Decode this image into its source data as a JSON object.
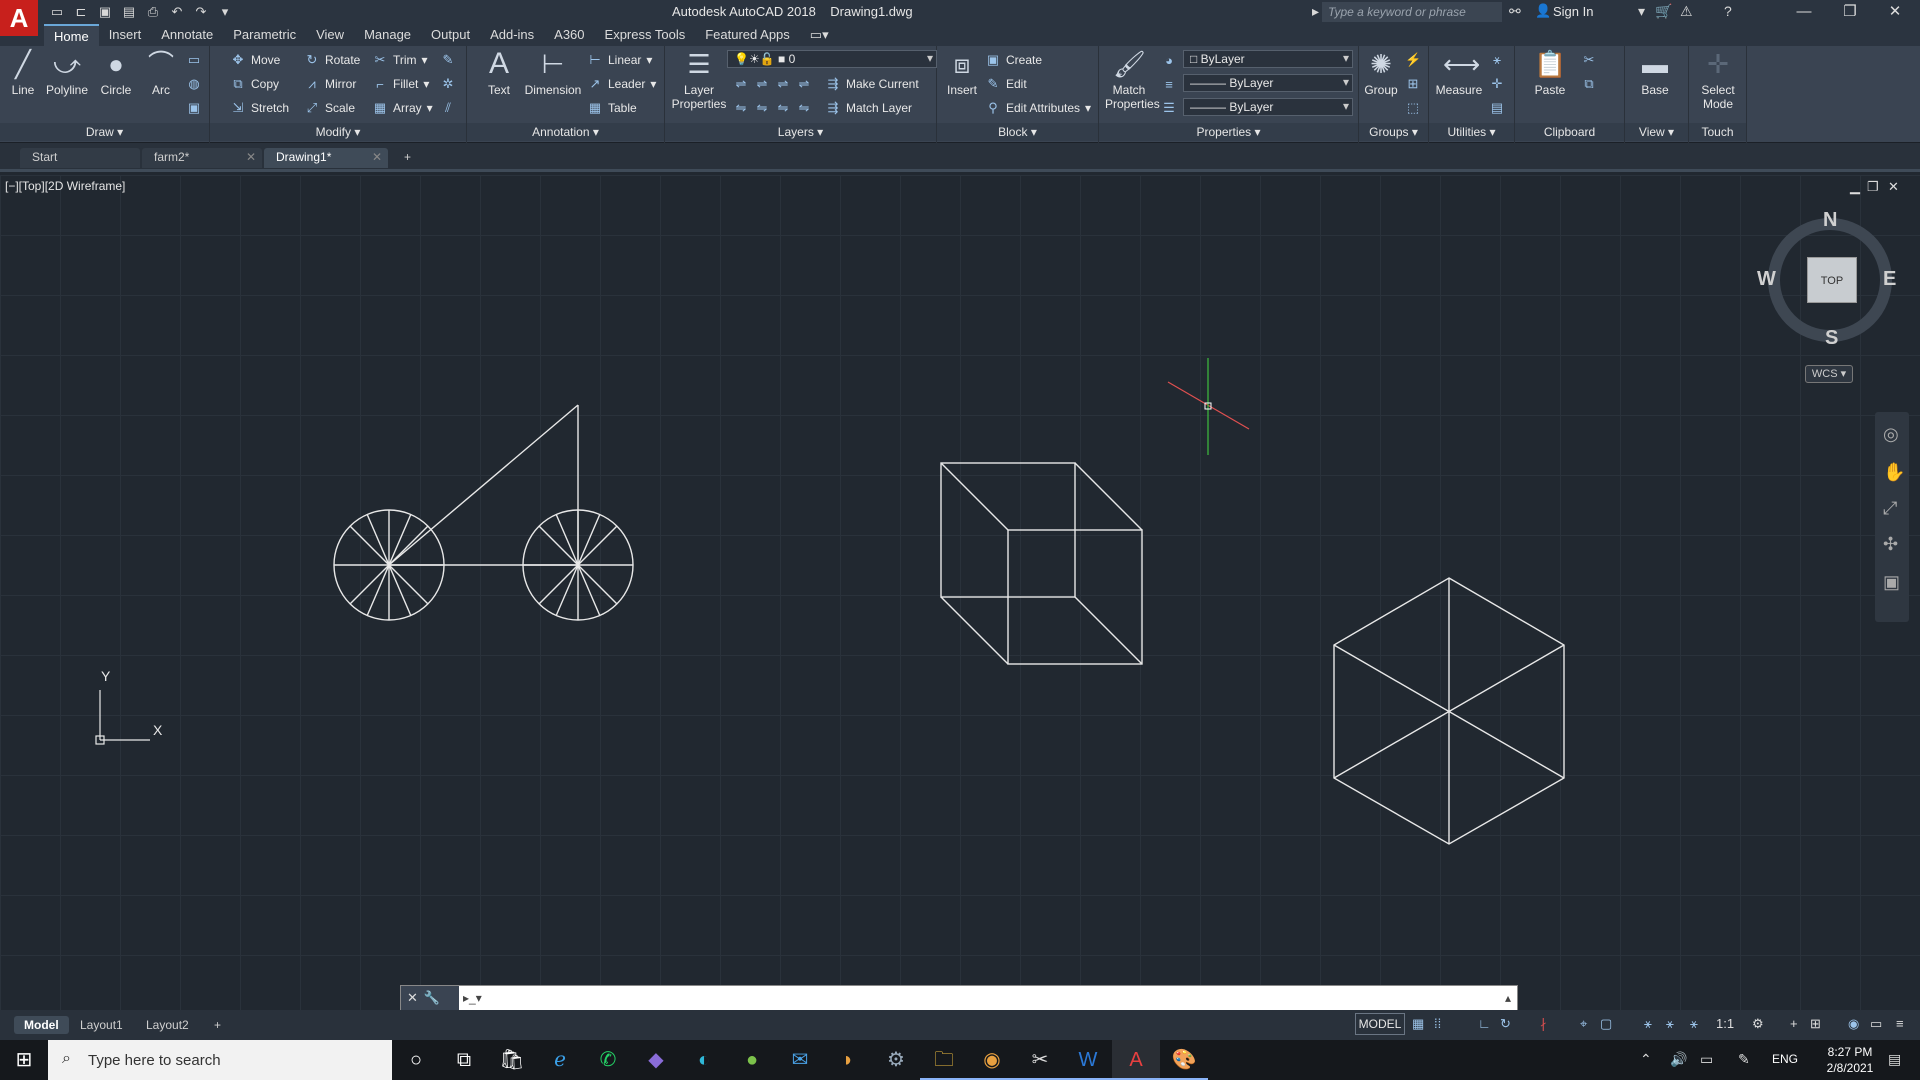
{
  "window": {
    "app_title": "Autodesk AutoCAD 2018    Drawing1.dwg",
    "search_placeholder": "Type a keyword or phrase",
    "sign_in": "Sign In"
  },
  "ribbon_tabs": [
    "Home",
    "Insert",
    "Annotate",
    "Parametric",
    "View",
    "Manage",
    "Output",
    "Add-ins",
    "A360",
    "Express Tools",
    "Featured Apps"
  ],
  "ribbon": {
    "draw": {
      "title": "Draw",
      "line": "Line",
      "polyline": "Polyline",
      "circle": "Circle",
      "arc": "Arc"
    },
    "modify": {
      "title": "Modify",
      "move": "Move",
      "rotate": "Rotate",
      "trim": "Trim",
      "copy": "Copy",
      "mirror": "Mirror",
      "fillet": "Fillet",
      "stretch": "Stretch",
      "scale": "Scale",
      "array": "Array"
    },
    "annotation": {
      "title": "Annotation",
      "text": "Text",
      "dimension": "Dimension",
      "linear": "Linear",
      "leader": "Leader",
      "table": "Table"
    },
    "layers": {
      "title": "Layers",
      "layer_properties": "Layer Properties",
      "current_layer": "0",
      "make_current": "Make Current",
      "match_layer": "Match Layer"
    },
    "block": {
      "title": "Block",
      "insert": "Insert",
      "create": "Create",
      "edit": "Edit",
      "edit_attributes": "Edit Attributes"
    },
    "properties": {
      "title": "Properties",
      "match_properties": "Match Properties",
      "color": "ByLayer",
      "linetype": "ByLayer",
      "lineweight": "ByLayer"
    },
    "groups": {
      "title": "Groups",
      "group": "Group"
    },
    "utilities": {
      "title": "Utilities",
      "measure": "Measure"
    },
    "clipboard": {
      "title": "Clipboard",
      "paste": "Paste"
    },
    "view": {
      "title": "View",
      "base": "Base"
    },
    "touch": {
      "title": "Touch",
      "select_mode": "Select Mode"
    }
  },
  "file_tabs": [
    "Start",
    "farm2*",
    "Drawing1*"
  ],
  "viewport": {
    "label": "[−][Top][2D Wireframe]",
    "viewcube": {
      "n": "N",
      "s": "S",
      "e": "E",
      "w": "W",
      "face": "TOP"
    },
    "wcs": "WCS",
    "ucs_x": "X",
    "ucs_y": "Y"
  },
  "layout_tabs": [
    "Model",
    "Layout1",
    "Layout2"
  ],
  "status_bar": {
    "model": "MODEL",
    "scale": "1:1"
  },
  "taskbar": {
    "search_placeholder": "Type here to search",
    "language": "ENG",
    "time": "8:27 PM",
    "date": "2/8/2021"
  },
  "colors": {
    "canvas": "#212830",
    "ribbon": "#3a4452",
    "accent": "#c8201c",
    "crosshair_x": "#e05050",
    "crosshair_y": "#3fbf3f"
  }
}
